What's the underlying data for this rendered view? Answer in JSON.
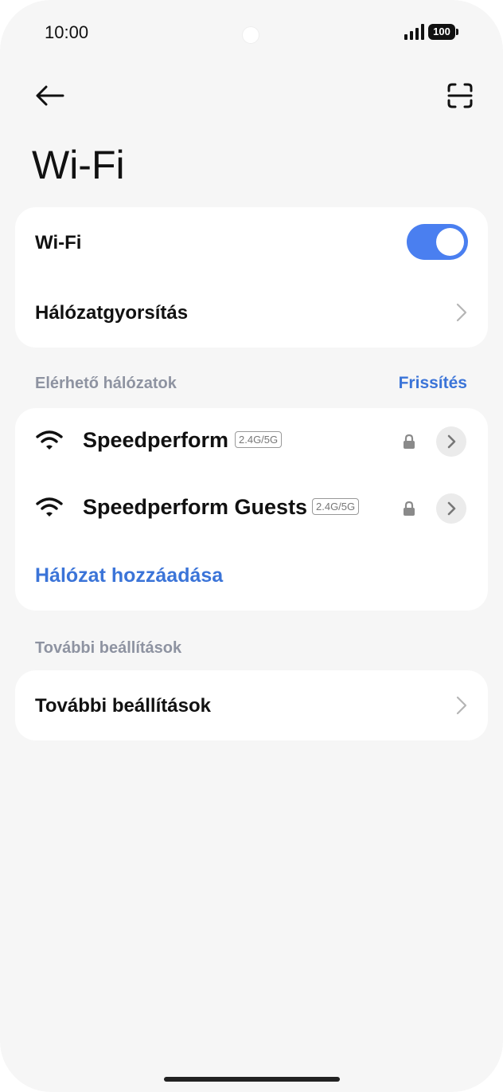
{
  "status_bar": {
    "time": "10:00",
    "battery": "100"
  },
  "header": {
    "title": "Wi-Fi",
    "back_icon": "arrow-left-icon",
    "scan_icon": "scan-qr-icon"
  },
  "wifi_card": {
    "wifi_label": "Wi-Fi",
    "wifi_enabled": true,
    "acceleration_label": "Hálózatgyorsítás"
  },
  "available": {
    "section_label": "Elérhető hálózatok",
    "refresh_label": "Frissítés",
    "networks": [
      {
        "name": "Speedperform",
        "band": "2.4G/5G",
        "secured": true
      },
      {
        "name": "Speedperform Guests",
        "band": "2.4G/5G",
        "secured": true
      }
    ],
    "add_network_label": "Hálózat hozzáadása"
  },
  "more": {
    "section_label": "További beállítások",
    "item_label": "További beállítások"
  },
  "colors": {
    "accent": "#4a7ff0",
    "link": "#3b74d8",
    "background": "#f6f6f6"
  }
}
